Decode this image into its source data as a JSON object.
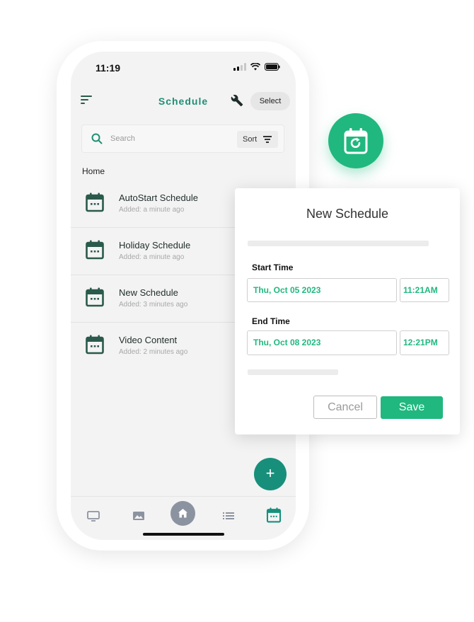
{
  "status": {
    "time": "11:19"
  },
  "appbar": {
    "title": "Schedule",
    "select_label": "Select"
  },
  "search": {
    "placeholder": "Search",
    "sort_label": "Sort"
  },
  "breadcrumb": "Home",
  "items": [
    {
      "name": "AutoStart Schedule",
      "added": "Added: a minute ago"
    },
    {
      "name": "Holiday Schedule",
      "added": "Added: a minute ago"
    },
    {
      "name": "New Schedule",
      "added": "Added: 3 minutes ago"
    },
    {
      "name": "Video Content",
      "added": "Added: 2 minutes ago"
    }
  ],
  "fab": {
    "label": "+"
  },
  "bottom_nav": [
    {
      "icon": "monitor-icon"
    },
    {
      "icon": "image-icon"
    },
    {
      "icon": "home-icon",
      "active": true
    },
    {
      "icon": "list-icon"
    },
    {
      "icon": "calendar-icon",
      "selected": true
    }
  ],
  "dialog": {
    "title": "New Schedule",
    "start_label": "Start Time",
    "start_date": "Thu, Oct 05 2023",
    "start_time": "11:21AM",
    "end_label": "End Time",
    "end_date": "Thu, Oct 08 2023",
    "end_time": "12:21PM",
    "cancel_label": "Cancel",
    "save_label": "Save"
  },
  "colors": {
    "accent": "#20b87f",
    "teal": "#1f8f74",
    "dark_green": "#2a5a4c"
  }
}
